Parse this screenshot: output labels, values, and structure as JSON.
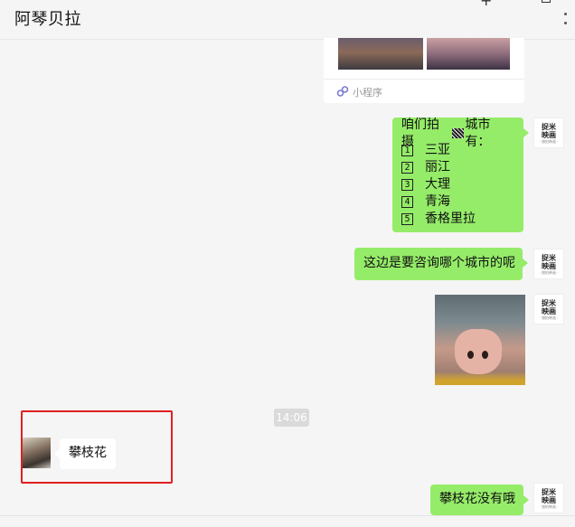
{
  "header": {
    "title": "阿琴贝拉",
    "plus_icon": "+"
  },
  "mini_program_card": {
    "label": "小程序"
  },
  "my_avatar": {
    "line1": "捉米",
    "line2": "映画",
    "line3": "· 旅拍映画 ·"
  },
  "messages": {
    "cities_intro": "咱们拍摄",
    "cities_intro_suffix": "城市有：",
    "cities": [
      {
        "num": "1",
        "name": "三亚"
      },
      {
        "num": "2",
        "name": "丽江"
      },
      {
        "num": "3",
        "name": "大理"
      },
      {
        "num": "4",
        "name": "青海"
      },
      {
        "num": "5",
        "name": "香格里拉"
      }
    ],
    "ask_city": "这边是要咨询哪个城市的呢",
    "timestamp": "14:06",
    "customer_reply": "攀枝花",
    "no_option": "攀枝花没有哦"
  },
  "colors": {
    "my_bubble": "#95ec69",
    "other_bubble": "#ffffff",
    "highlight_border": "#e02020",
    "background": "#f5f5f5"
  }
}
